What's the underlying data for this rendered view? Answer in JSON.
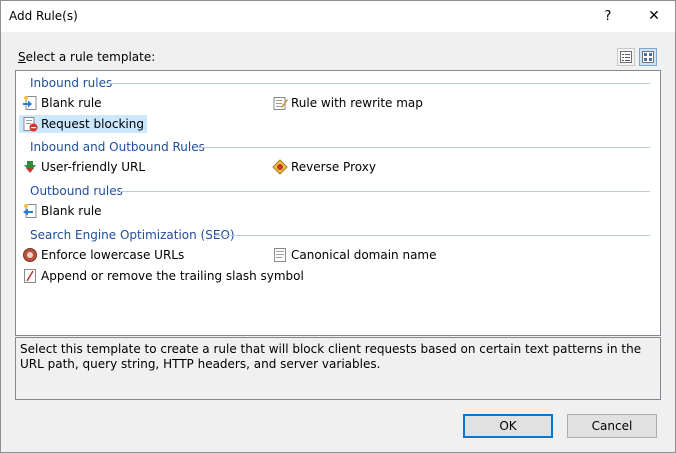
{
  "window": {
    "title": "Add Rule(s)",
    "help_glyph": "?",
    "close_glyph": "✕"
  },
  "select_label": {
    "accel": "S",
    "rest": "elect a rule template:"
  },
  "view_buttons": [
    "details-view-icon",
    "tile-view-icon"
  ],
  "groups": {
    "inbound": {
      "title": "Inbound rules",
      "items": [
        "Blank rule",
        "Rule with rewrite map",
        "Request blocking"
      ]
    },
    "inout": {
      "title": "Inbound and Outbound Rules",
      "items": [
        "User-friendly URL",
        "Reverse Proxy"
      ]
    },
    "outbound": {
      "title": "Outbound rules",
      "items": [
        "Blank rule"
      ]
    },
    "seo": {
      "title": "Search Engine Optimization (SEO)",
      "items": [
        "Enforce lowercase URLs",
        "Canonical domain name",
        "Append or remove the trailing slash symbol"
      ]
    }
  },
  "selected_item": "Request blocking",
  "description": "Select this template to create a rule that will block client requests based on certain text patterns in the URL path, query string, HTTP headers, and server variables.",
  "buttons": {
    "ok": "OK",
    "cancel": "Cancel"
  },
  "colors": {
    "group_text": "#1e4e9a",
    "selection": "#cce8ff",
    "default_button_border": "#0078d7"
  }
}
